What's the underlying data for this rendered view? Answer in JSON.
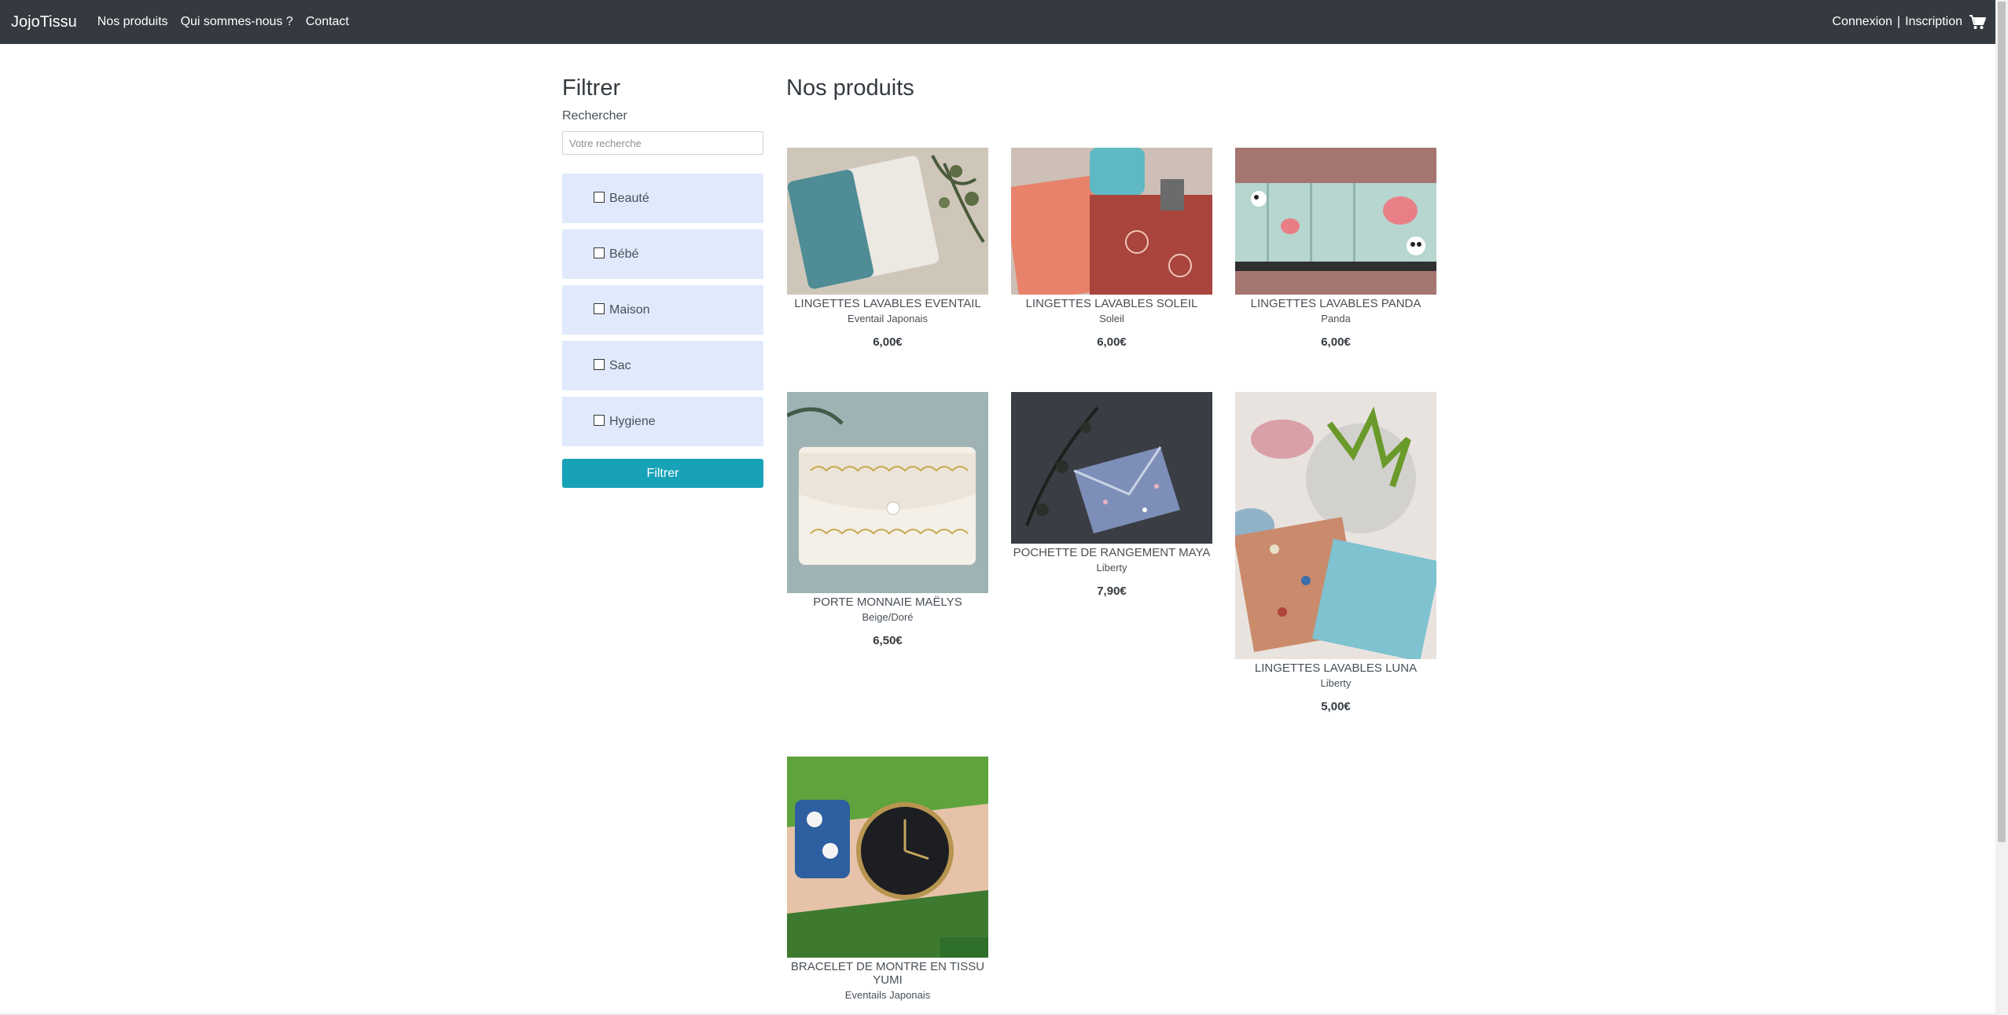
{
  "navbar": {
    "brand": "JojoTissu",
    "links": [
      "Nos produits",
      "Qui sommes-nous ?",
      "Contact"
    ],
    "login": "Connexion",
    "separator": "|",
    "register": "Inscription",
    "cart_icon": "cart-icon"
  },
  "sidebar": {
    "title": "Filtrer",
    "search_label": "Rechercher",
    "search_placeholder": "Votre recherche",
    "categories": [
      "Beauté",
      "Bébé",
      "Maison",
      "Sac",
      "Hygiene"
    ],
    "filter_button": "Filtrer"
  },
  "main": {
    "title": "Nos produits",
    "products": [
      {
        "name": "LINGETTES LAVABLES EVENTAIL",
        "variant": "Eventail Japonais",
        "price": "6,00€"
      },
      {
        "name": "LINGETTES LAVABLES SOLEIL",
        "variant": "Soleil",
        "price": "6,00€"
      },
      {
        "name": "LINGETTES LAVABLES PANDA",
        "variant": "Panda",
        "price": "6,00€"
      },
      {
        "name": "PORTE MONNAIE MAËLYS",
        "variant": "Beige/Doré",
        "price": "6,50€"
      },
      {
        "name": "POCHETTE DE RANGEMENT MAYA",
        "variant": "Liberty",
        "price": "7,90€"
      },
      {
        "name": "LINGETTES LAVABLES LUNA",
        "variant": "Liberty",
        "price": "5,00€"
      },
      {
        "name": "BRACELET DE MONTRE EN TISSU YUMI",
        "variant": "Eventails Japonais",
        "price": ""
      }
    ]
  },
  "colors": {
    "navbar": "#343a40",
    "category_bg": "#e0eafc",
    "accent": "#17a2b8"
  }
}
